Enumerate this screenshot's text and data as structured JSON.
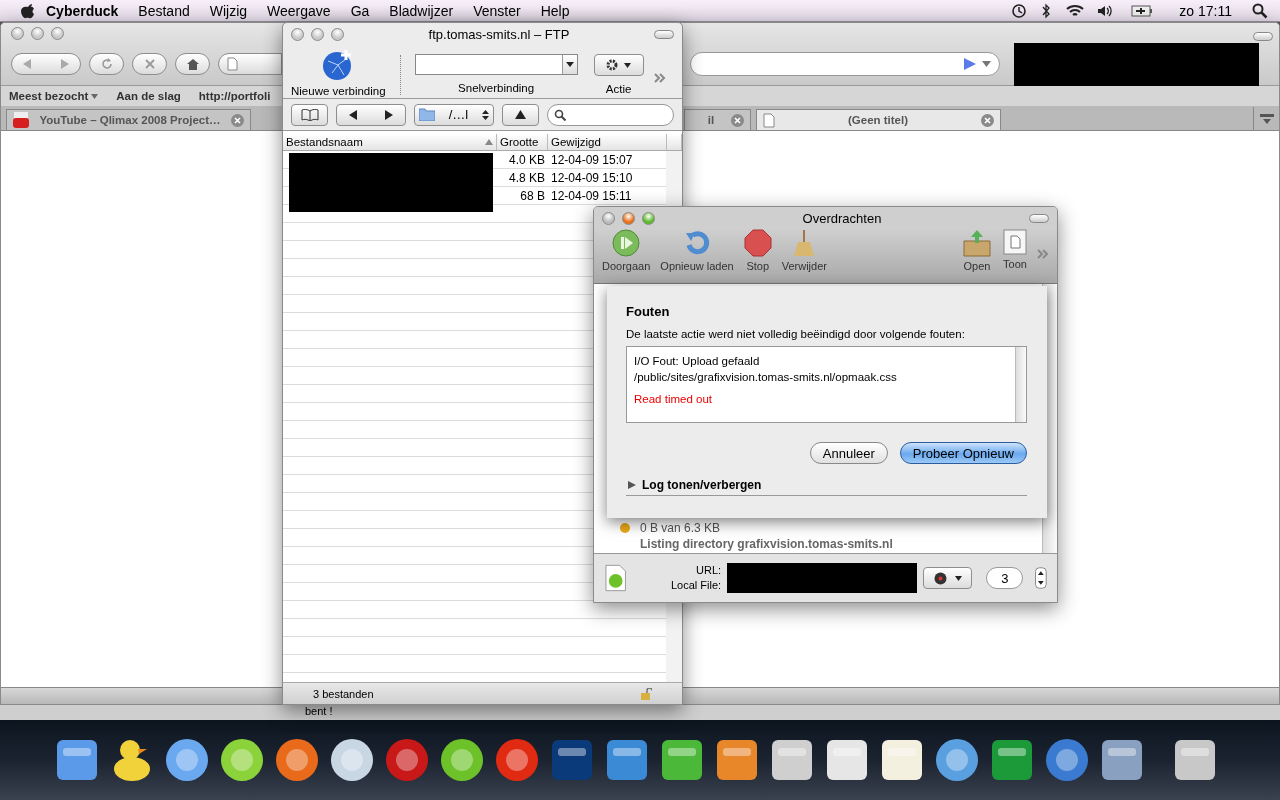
{
  "menu_bar": {
    "app": "Cyberduck",
    "menus": [
      "Bestand",
      "Wijzig",
      "Weergave",
      "Ga",
      "Bladwijzer",
      "Venster",
      "Help"
    ],
    "clock": "zo 17:11"
  },
  "browser": {
    "bookmarks": [
      {
        "label": "Meest bezocht",
        "kind": "menu"
      },
      {
        "label": "Aan de slag",
        "kind": "link"
      },
      {
        "label": "http://portfoli",
        "kind": "link"
      }
    ],
    "tabs": [
      {
        "label": "YouTube – Qlimax 2008 Project…",
        "kind": "video",
        "selected": false
      },
      {
        "label": "il",
        "kind": "page",
        "selected": false
      },
      {
        "label": "(Geen titel)",
        "kind": "page",
        "selected": true
      }
    ]
  },
  "background_window": {
    "text": "bent !"
  },
  "ftp_window": {
    "title": "ftp.tomas-smits.nl – FTP",
    "toolbar": {
      "new_connection": "Nieuwe verbinding",
      "quick_connect": "Snelverbinding",
      "action": "Actie"
    },
    "path": "/…l",
    "columns": [
      "Bestandsnaam",
      "Grootte",
      "Gewijzigd"
    ],
    "rows": [
      {
        "size": "4.0 KB",
        "modified": "12-04-09 15:07"
      },
      {
        "size": "4.8 KB",
        "modified": "12-04-09 15:10"
      },
      {
        "size": "68 B",
        "modified": "12-04-09 15:11"
      }
    ],
    "status": "3 bestanden"
  },
  "transfers": {
    "title": "Overdrachten",
    "toolbar": [
      {
        "label": "Doorgaan",
        "kind": "resume"
      },
      {
        "label": "Opnieuw laden",
        "kind": "reload"
      },
      {
        "label": "Stop",
        "kind": "stop"
      },
      {
        "label": "Verwijder",
        "kind": "broom"
      }
    ],
    "toolbar_right": [
      {
        "label": "Open",
        "kind": "open"
      },
      {
        "label": "Toon",
        "kind": "show"
      }
    ],
    "item": {
      "progress": "0 B van 6.3 KB",
      "status": "Listing directory grafixvision.tomas-smits.nl"
    },
    "url_label": "URL:",
    "local_file_label": "Local File:",
    "connections": "3",
    "sheet": {
      "title": "Fouten",
      "message": "De laatste actie werd niet volledig beëindigd door volgende fouten:",
      "log": [
        {
          "text": "I/O Fout: Upload gefaald",
          "kind": "message"
        },
        {
          "text": "/public/sites/grafixvision.tomas-smits.nl/opmaak.css",
          "kind": "message"
        },
        {
          "text": "Read timed out",
          "kind": "error"
        }
      ],
      "buttons": [
        {
          "label": "Annuleer",
          "default": false
        },
        {
          "label": "Probeer Opnieuw",
          "default": true
        }
      ],
      "disclosure": {
        "label": "Log tonen/verbergen",
        "expanded": false
      }
    }
  }
}
